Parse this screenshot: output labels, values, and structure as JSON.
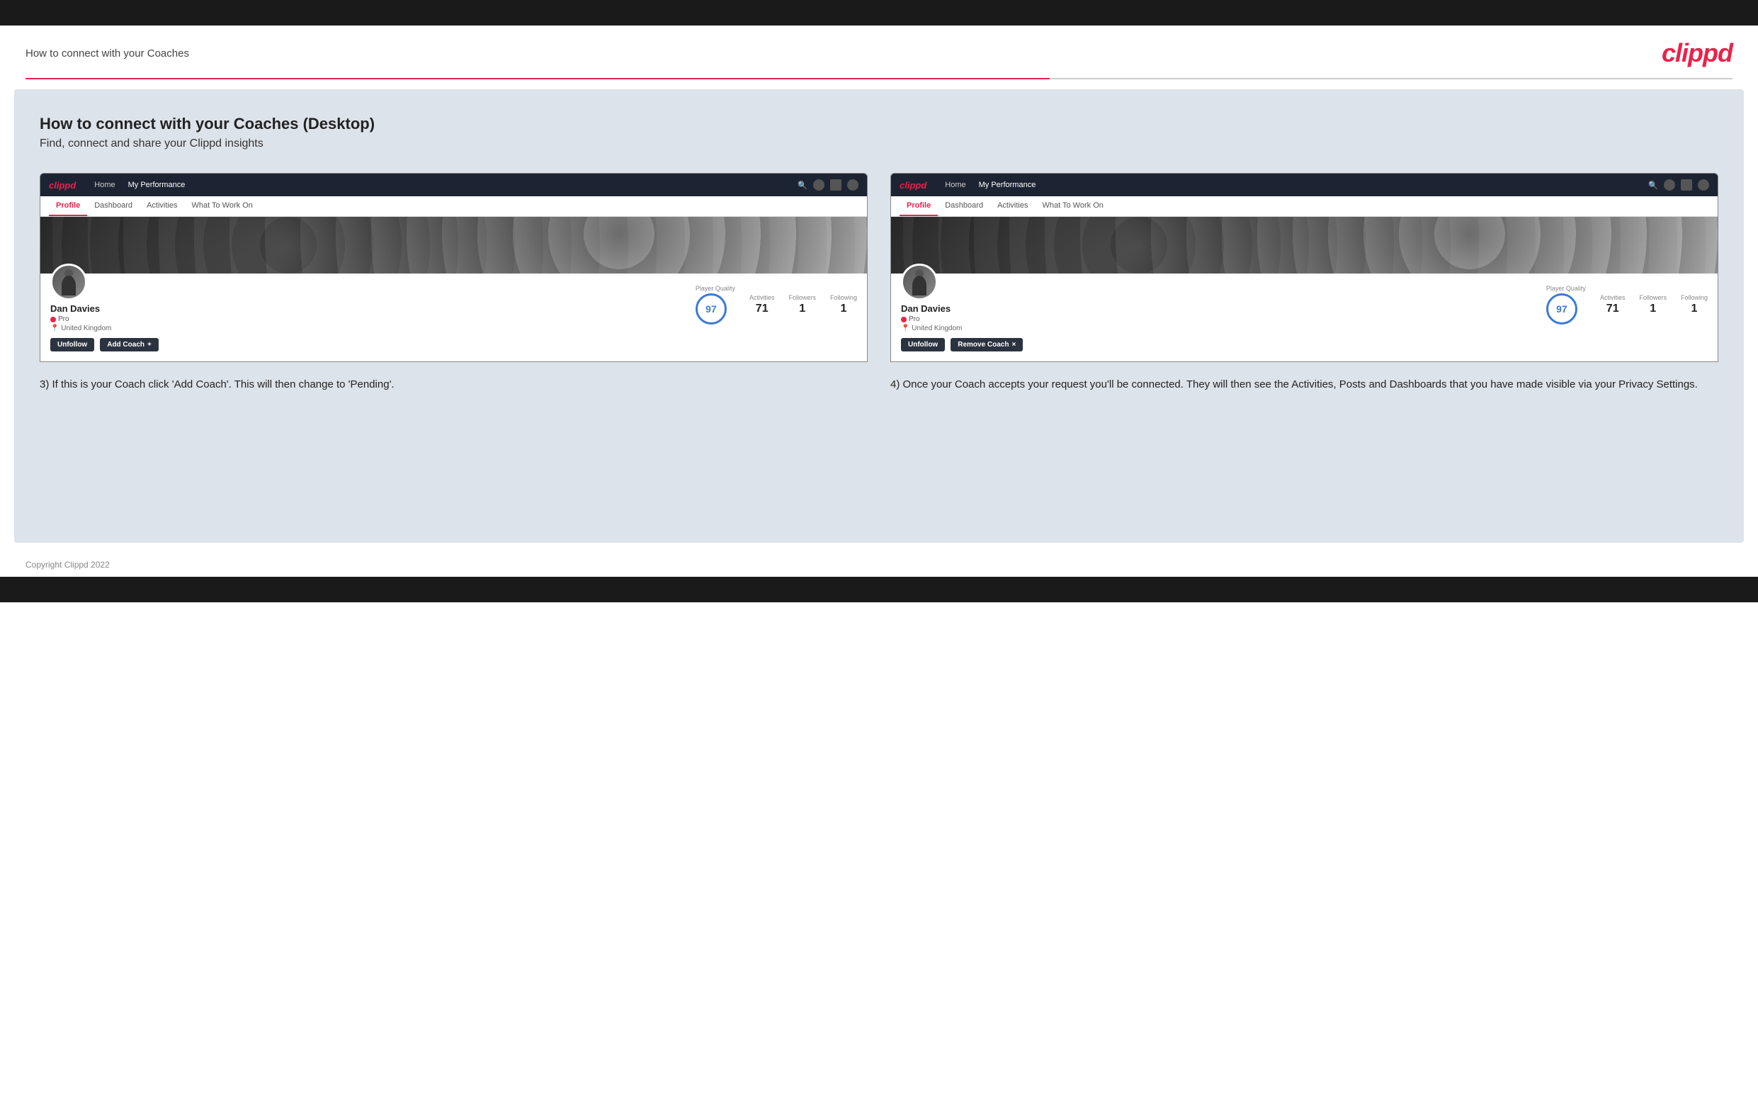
{
  "page": {
    "title": "How to connect with your Coaches",
    "logo": "clippd",
    "footer": "Copyright Clippd 2022"
  },
  "section": {
    "heading": "How to connect with your Coaches (Desktop)",
    "subheading": "Find, connect and share your Clippd insights"
  },
  "step3": {
    "description": "3) If this is your Coach click 'Add Coach'. This will then change to 'Pending'.",
    "browser": {
      "nav": {
        "logo": "clippd",
        "items": [
          "Home",
          "My Performance"
        ]
      },
      "tabs": [
        "Profile",
        "Dashboard",
        "Activities",
        "What To Work On"
      ],
      "active_tab": "Profile",
      "player": {
        "name": "Dan Davies",
        "tag": "Pro",
        "location": "United Kingdom",
        "quality_label": "Player Quality",
        "quality_value": "97",
        "activities_label": "Activities",
        "activities_value": "71",
        "followers_label": "Followers",
        "followers_value": "1",
        "following_label": "Following",
        "following_value": "1"
      },
      "buttons": [
        "Unfollow",
        "Add Coach +"
      ]
    }
  },
  "step4": {
    "description": "4) Once your Coach accepts your request you'll be connected. They will then see the Activities, Posts and Dashboards that you have made visible via your Privacy Settings.",
    "browser": {
      "nav": {
        "logo": "clippd",
        "items": [
          "Home",
          "My Performance"
        ]
      },
      "tabs": [
        "Profile",
        "Dashboard",
        "Activities",
        "What To Work On"
      ],
      "active_tab": "Profile",
      "player": {
        "name": "Dan Davies",
        "tag": "Pro",
        "location": "United Kingdom",
        "quality_label": "Player Quality",
        "quality_value": "97",
        "activities_label": "Activities",
        "activities_value": "71",
        "followers_label": "Followers",
        "followers_value": "1",
        "following_label": "Following",
        "following_value": "1"
      },
      "buttons": [
        "Unfollow",
        "Remove Coach ×"
      ]
    }
  }
}
